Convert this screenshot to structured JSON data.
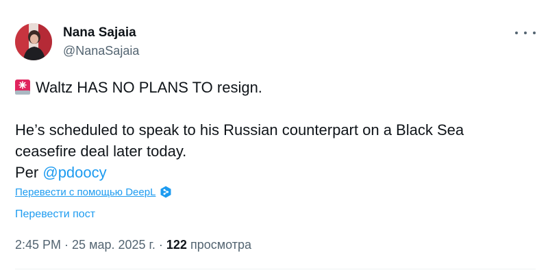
{
  "author": {
    "name": "Nana Sajaia",
    "handle": "@NanaSajaia"
  },
  "tweet": {
    "line1": "Waltz HAS NO PLANS TO resign.",
    "line2": "He’s scheduled to speak to his Russian counterpart on a Black Sea",
    "line3": "ceasefire deal later today.",
    "per_prefix": "Per ",
    "mention": "@pdoocy",
    "siren_icon": "rotating-light-emoji"
  },
  "translation": {
    "deepl_link": "Перевести с помощью DeepL",
    "translate_post": "Перевести пост"
  },
  "meta": {
    "time": "2:45 PM",
    "separator": " · ",
    "date": "25 мар. 2025 г.",
    "views_count": "122",
    "views_label": "просмотра"
  },
  "colors": {
    "accent": "#1d9bf0",
    "text": "#0f1419",
    "secondary": "#536471"
  }
}
